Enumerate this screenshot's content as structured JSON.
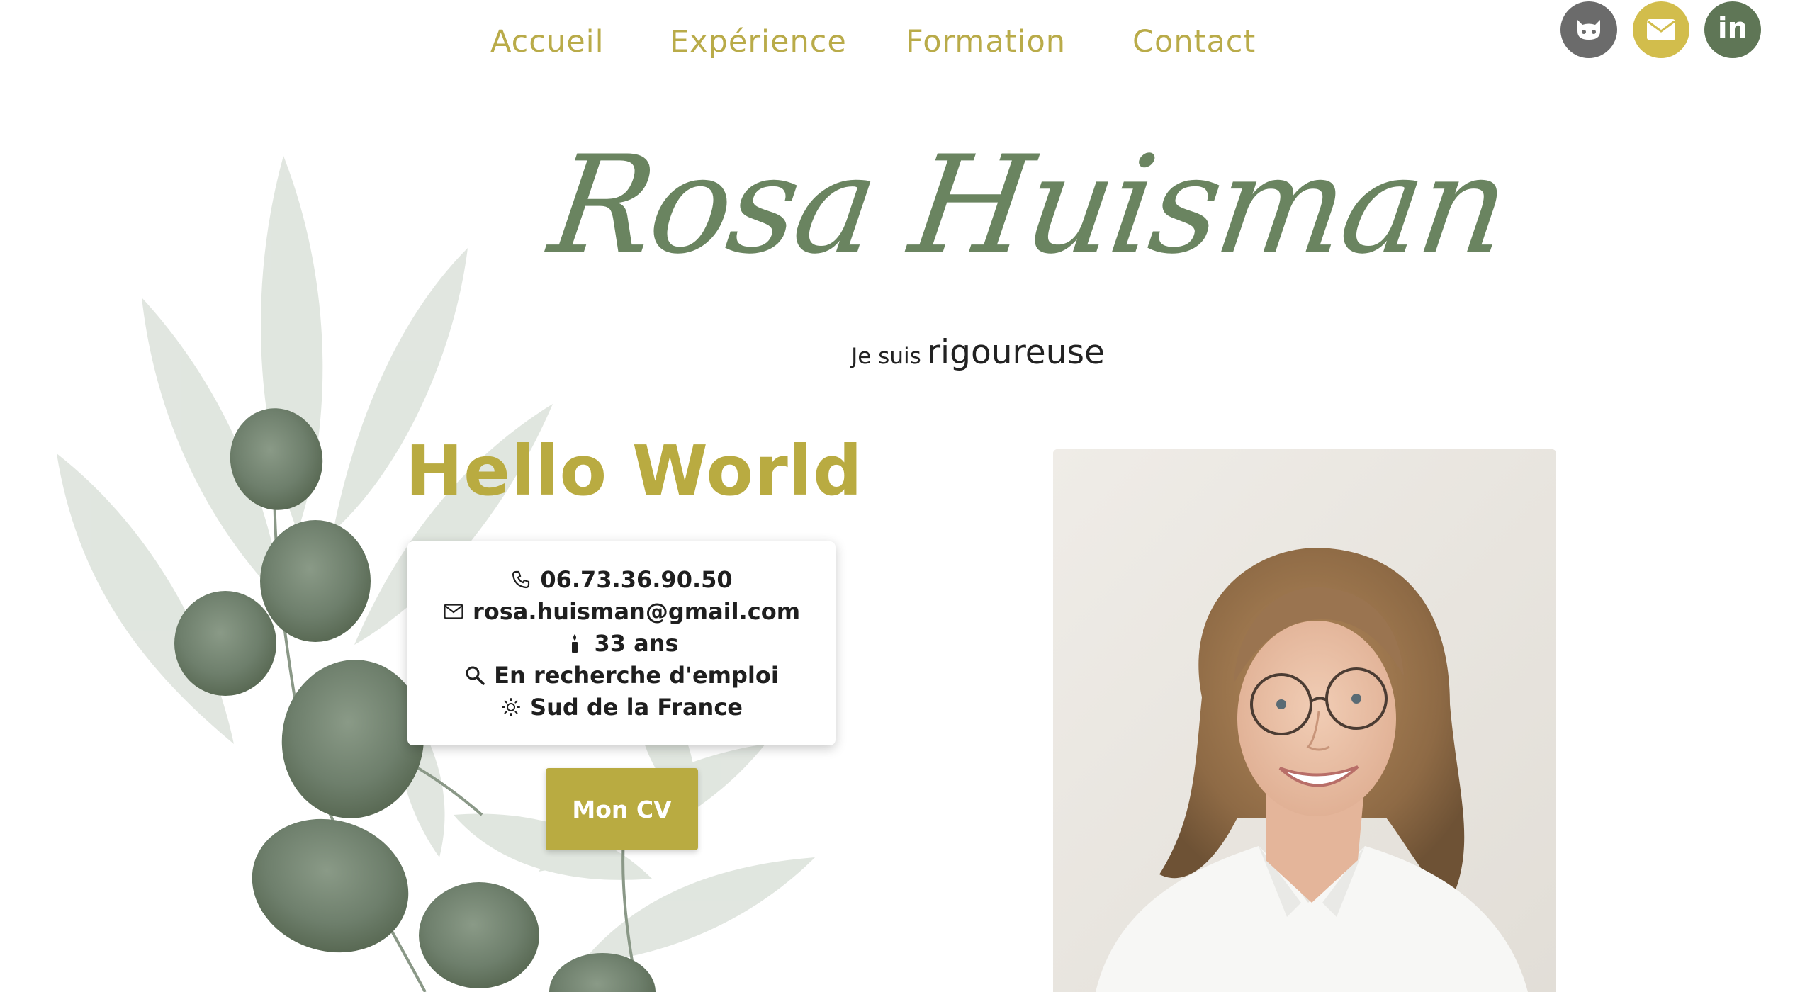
{
  "nav": {
    "items": [
      {
        "label": "Accueil"
      },
      {
        "label": "Expérience"
      },
      {
        "label": "Formation"
      },
      {
        "label": "Contact"
      }
    ]
  },
  "social": {
    "links": [
      {
        "icon": "github-icon",
        "color": "#6b6b6b"
      },
      {
        "icon": "envelope-icon",
        "color": "#d2bd4c"
      },
      {
        "icon": "linkedin-icon",
        "color": "#5f7656",
        "glyph": "in"
      }
    ]
  },
  "hero": {
    "name": "Rosa Huisman",
    "tagline_prefix": "Je suis",
    "tagline_word": "rigoureuse"
  },
  "intro": {
    "heading": "Hello World"
  },
  "info": {
    "phone": {
      "icon": "phone-icon",
      "text": "06.73.36.90.50"
    },
    "email": {
      "icon": "envelope-outline-icon",
      "text": "rosa.huisman@gmail.com"
    },
    "age": {
      "icon": "candle-icon",
      "text": "33 ans"
    },
    "status": {
      "icon": "search-icon",
      "text": "En recherche d'emploi"
    },
    "location": {
      "icon": "sun-icon",
      "text": "Sud de la France"
    }
  },
  "cv_button": {
    "label": "Mon CV"
  },
  "colors": {
    "accent_gold": "#b9ab41",
    "leaf_green": "#6a8460",
    "text_dark": "#1f1f1f"
  }
}
